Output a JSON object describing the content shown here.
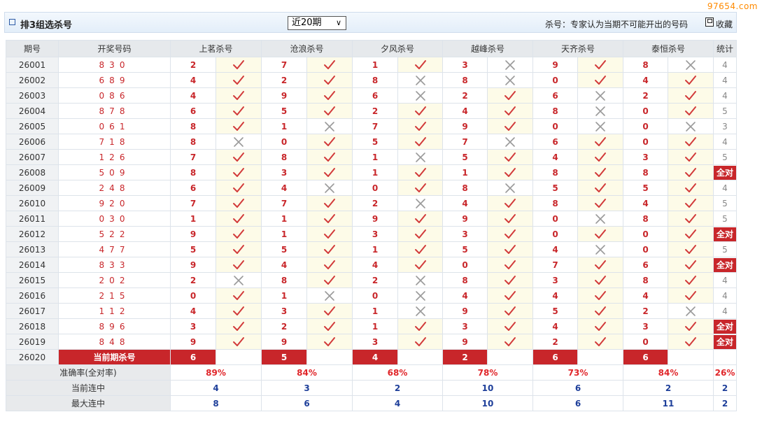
{
  "watermark": "97654.com",
  "header": {
    "title": "排3组选杀号",
    "period_select": "近20期",
    "note": "杀号：专家认为当期不可能开出的号码",
    "favorite": "收藏"
  },
  "columns": {
    "period": "期号",
    "draw": "开奖号码",
    "experts": [
      "上茗杀号",
      "沧浪杀号",
      "夕风杀号",
      "越峰杀号",
      "天齐杀号",
      "泰恒杀号"
    ],
    "stat": "统计"
  },
  "rows": [
    {
      "period": "26001",
      "draw": "830",
      "kills": [
        [
          "2",
          "ok"
        ],
        [
          "7",
          "ok"
        ],
        [
          "1",
          "ok"
        ],
        [
          "3",
          "miss"
        ],
        [
          "9",
          "ok"
        ],
        [
          "8",
          "miss"
        ]
      ],
      "stat": "4"
    },
    {
      "period": "26002",
      "draw": "689",
      "kills": [
        [
          "4",
          "ok"
        ],
        [
          "2",
          "ok"
        ],
        [
          "8",
          "miss"
        ],
        [
          "8",
          "miss"
        ],
        [
          "0",
          "ok"
        ],
        [
          "4",
          "ok"
        ]
      ],
      "stat": "4"
    },
    {
      "period": "26003",
      "draw": "086",
      "kills": [
        [
          "4",
          "ok"
        ],
        [
          "9",
          "ok"
        ],
        [
          "6",
          "miss"
        ],
        [
          "2",
          "ok"
        ],
        [
          "6",
          "miss"
        ],
        [
          "2",
          "ok"
        ]
      ],
      "stat": "4"
    },
    {
      "period": "26004",
      "draw": "878",
      "kills": [
        [
          "6",
          "ok"
        ],
        [
          "5",
          "ok"
        ],
        [
          "2",
          "ok"
        ],
        [
          "4",
          "ok"
        ],
        [
          "8",
          "miss"
        ],
        [
          "0",
          "ok"
        ]
      ],
      "stat": "5"
    },
    {
      "period": "26005",
      "draw": "061",
      "kills": [
        [
          "8",
          "ok"
        ],
        [
          "1",
          "miss"
        ],
        [
          "7",
          "ok"
        ],
        [
          "9",
          "ok"
        ],
        [
          "0",
          "miss"
        ],
        [
          "0",
          "miss"
        ]
      ],
      "stat": "3"
    },
    {
      "period": "26006",
      "draw": "718",
      "kills": [
        [
          "8",
          "miss"
        ],
        [
          "0",
          "ok"
        ],
        [
          "5",
          "ok"
        ],
        [
          "7",
          "miss"
        ],
        [
          "6",
          "ok"
        ],
        [
          "0",
          "ok"
        ]
      ],
      "stat": "4"
    },
    {
      "period": "26007",
      "draw": "126",
      "kills": [
        [
          "7",
          "ok"
        ],
        [
          "8",
          "ok"
        ],
        [
          "1",
          "miss"
        ],
        [
          "5",
          "ok"
        ],
        [
          "4",
          "ok"
        ],
        [
          "3",
          "ok"
        ]
      ],
      "stat": "5"
    },
    {
      "period": "26008",
      "draw": "509",
      "kills": [
        [
          "8",
          "ok"
        ],
        [
          "3",
          "ok"
        ],
        [
          "1",
          "ok"
        ],
        [
          "1",
          "ok"
        ],
        [
          "8",
          "ok"
        ],
        [
          "8",
          "ok"
        ]
      ],
      "stat": "全对"
    },
    {
      "period": "26009",
      "draw": "248",
      "kills": [
        [
          "6",
          "ok"
        ],
        [
          "4",
          "miss"
        ],
        [
          "0",
          "ok"
        ],
        [
          "8",
          "miss"
        ],
        [
          "5",
          "ok"
        ],
        [
          "5",
          "ok"
        ]
      ],
      "stat": "4"
    },
    {
      "period": "26010",
      "draw": "920",
      "kills": [
        [
          "7",
          "ok"
        ],
        [
          "7",
          "ok"
        ],
        [
          "2",
          "miss"
        ],
        [
          "4",
          "ok"
        ],
        [
          "8",
          "ok"
        ],
        [
          "4",
          "ok"
        ]
      ],
      "stat": "5"
    },
    {
      "period": "26011",
      "draw": "030",
      "kills": [
        [
          "1",
          "ok"
        ],
        [
          "1",
          "ok"
        ],
        [
          "9",
          "ok"
        ],
        [
          "9",
          "ok"
        ],
        [
          "0",
          "miss"
        ],
        [
          "8",
          "ok"
        ]
      ],
      "stat": "5"
    },
    {
      "period": "26012",
      "draw": "522",
      "kills": [
        [
          "9",
          "ok"
        ],
        [
          "1",
          "ok"
        ],
        [
          "3",
          "ok"
        ],
        [
          "3",
          "ok"
        ],
        [
          "0",
          "ok"
        ],
        [
          "0",
          "ok"
        ]
      ],
      "stat": "全对"
    },
    {
      "period": "26013",
      "draw": "477",
      "kills": [
        [
          "5",
          "ok"
        ],
        [
          "5",
          "ok"
        ],
        [
          "1",
          "ok"
        ],
        [
          "5",
          "ok"
        ],
        [
          "4",
          "miss"
        ],
        [
          "0",
          "ok"
        ]
      ],
      "stat": "5"
    },
    {
      "period": "26014",
      "draw": "833",
      "kills": [
        [
          "9",
          "ok"
        ],
        [
          "4",
          "ok"
        ],
        [
          "4",
          "ok"
        ],
        [
          "0",
          "ok"
        ],
        [
          "7",
          "ok"
        ],
        [
          "6",
          "ok"
        ]
      ],
      "stat": "全对"
    },
    {
      "period": "26015",
      "draw": "202",
      "kills": [
        [
          "2",
          "miss"
        ],
        [
          "8",
          "ok"
        ],
        [
          "2",
          "miss"
        ],
        [
          "8",
          "ok"
        ],
        [
          "3",
          "ok"
        ],
        [
          "8",
          "ok"
        ]
      ],
      "stat": "4"
    },
    {
      "period": "26016",
      "draw": "215",
      "kills": [
        [
          "0",
          "ok"
        ],
        [
          "1",
          "miss"
        ],
        [
          "0",
          "miss"
        ],
        [
          "4",
          "ok"
        ],
        [
          "4",
          "ok"
        ],
        [
          "4",
          "ok"
        ]
      ],
      "stat": "4"
    },
    {
      "period": "26017",
      "draw": "112",
      "kills": [
        [
          "4",
          "ok"
        ],
        [
          "3",
          "ok"
        ],
        [
          "1",
          "miss"
        ],
        [
          "9",
          "ok"
        ],
        [
          "5",
          "ok"
        ],
        [
          "2",
          "miss"
        ]
      ],
      "stat": "4"
    },
    {
      "period": "26018",
      "draw": "896",
      "kills": [
        [
          "3",
          "ok"
        ],
        [
          "2",
          "ok"
        ],
        [
          "1",
          "ok"
        ],
        [
          "3",
          "ok"
        ],
        [
          "4",
          "ok"
        ],
        [
          "3",
          "ok"
        ]
      ],
      "stat": "全对"
    },
    {
      "period": "26019",
      "draw": "848",
      "kills": [
        [
          "9",
          "ok"
        ],
        [
          "9",
          "ok"
        ],
        [
          "3",
          "ok"
        ],
        [
          "9",
          "ok"
        ],
        [
          "2",
          "ok"
        ],
        [
          "0",
          "ok"
        ]
      ],
      "stat": "全对"
    }
  ],
  "current": {
    "period": "26020",
    "label": "当前期杀号",
    "kills": [
      "6",
      "5",
      "4",
      "2",
      "6",
      "6"
    ]
  },
  "summary": {
    "accuracy_label": "准确率(全对率)",
    "accuracy": [
      "89%",
      "84%",
      "68%",
      "78%",
      "73%",
      "84%"
    ],
    "accuracy_all": "26%",
    "current_streak_label": "当前连中",
    "current_streak": [
      "4",
      "3",
      "2",
      "10",
      "6",
      "2"
    ],
    "current_streak_all": "2",
    "max_streak_label": "最大连中",
    "max_streak": [
      "8",
      "6",
      "4",
      "10",
      "6",
      "11"
    ],
    "max_streak_all": "2"
  },
  "colors": {
    "accent_red": "#c8262a",
    "check_red": "#d23a3a",
    "cross_gray": "#9a9a9a",
    "streak_blue": "#1e3f9a",
    "result_bg": "#fdfbe8"
  }
}
